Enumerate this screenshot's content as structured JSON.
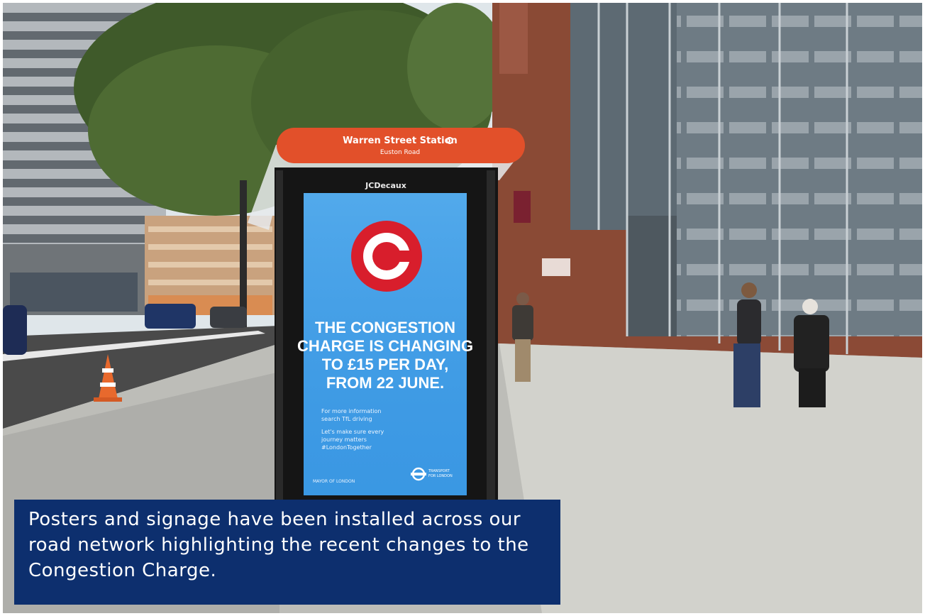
{
  "scene": {
    "description_free": true,
    "shelter": {
      "station_name": "Warren Street Station",
      "road_name": "Euston Road",
      "brand": "JCDecaux"
    },
    "poster": {
      "headline_lines": [
        "THE CONGESTION",
        "CHARGE IS CHANGING",
        "TO £15 PER DAY,",
        "FROM 22 JUNE."
      ],
      "info_lines": [
        "For more information",
        "search TfL driving"
      ],
      "message_lines": [
        "Let's make sure every",
        "journey matters",
        "#LondonTogether"
      ],
      "mayor_credit": "MAYOR OF LONDON",
      "tfl_lines": [
        "TRANSPORT",
        "FOR LONDON"
      ],
      "logo_letter": "C"
    },
    "colors": {
      "poster_blue": "#3f9de6",
      "roundel_red": "#d81e2c",
      "shelter_orange": "#e2502a",
      "caption_navy": "#0d2f6e"
    }
  },
  "caption": {
    "text": "Posters and signage have been installed across our road network highlighting the recent changes to the Congestion Charge."
  }
}
